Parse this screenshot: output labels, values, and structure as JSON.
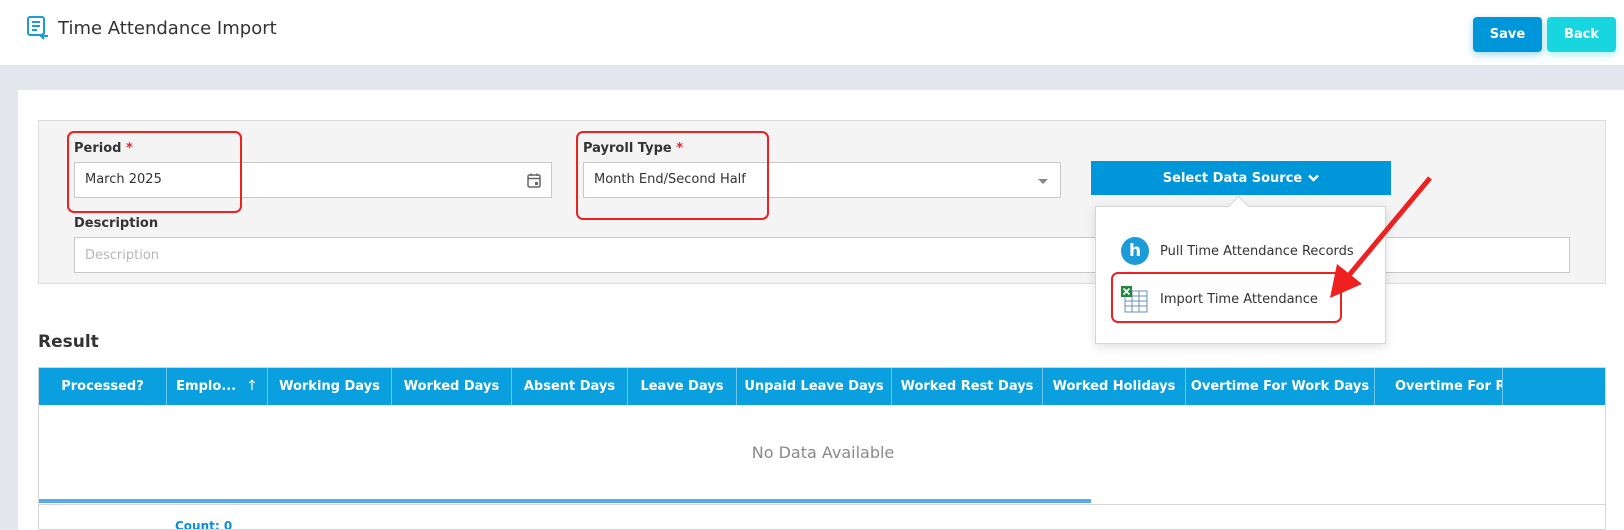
{
  "header": {
    "title": "Time Attendance Import",
    "save_label": "Save",
    "back_label": "Back"
  },
  "form": {
    "period_label": "Period",
    "period_value": "March 2025",
    "payroll_type_label": "Payroll Type",
    "payroll_type_value": "Month End/Second Half",
    "required_mark": "*",
    "description_label": "Description",
    "description_placeholder": "Description",
    "select_data_source_label": "Select Data Source"
  },
  "data_source_menu": {
    "items": [
      {
        "label": "Pull Time Attendance Records",
        "icon": "h-circle-icon"
      },
      {
        "label": "Import Time Attendance",
        "icon": "excel-grid-icon"
      }
    ]
  },
  "result": {
    "title": "Result",
    "columns": [
      "Processed?",
      "Emplo...",
      "Working Days",
      "Worked Days",
      "Absent Days",
      "Leave Days",
      "Unpaid Leave Days",
      "Worked Rest Days",
      "Worked Holidays",
      "Overtime For Work Days",
      "Overtime For Res"
    ],
    "empty_text": "No Data Available",
    "count_text": "Count: 0"
  },
  "colors": {
    "primary": "#0096da",
    "accent": "#18d6e0",
    "header_blue": "#0aa0e0",
    "highlight": "#ee2020"
  }
}
